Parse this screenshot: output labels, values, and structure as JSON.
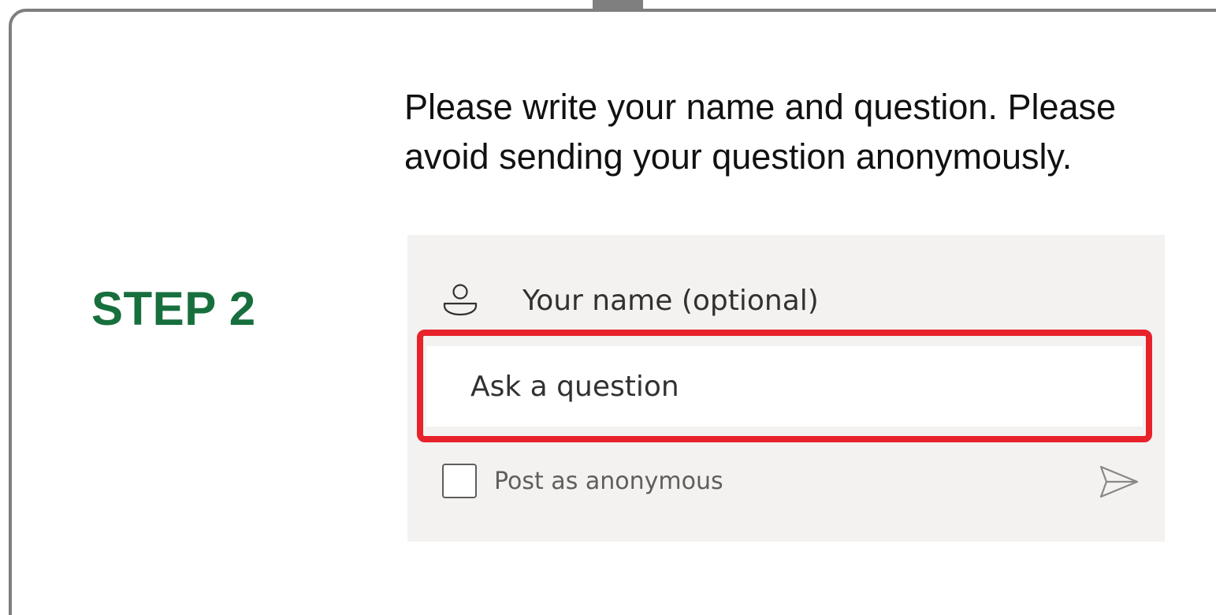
{
  "step": {
    "label": "STEP 2"
  },
  "instructions": {
    "text": "Please write your name and question. Please avoid sending your question anonymously."
  },
  "form": {
    "name_placeholder": "Your name (optional)",
    "name_value": "",
    "question_placeholder": "Ask a question",
    "question_value": "",
    "anonymous_label": "Post as anonymous",
    "anonymous_checked": false
  },
  "icons": {
    "name": "person-icon",
    "send": "send-icon"
  },
  "colors": {
    "step_label": "#176f3d",
    "highlight_border": "#e8222a",
    "frame_border": "#7f7f7f",
    "panel_background": "#f3f2f1"
  }
}
